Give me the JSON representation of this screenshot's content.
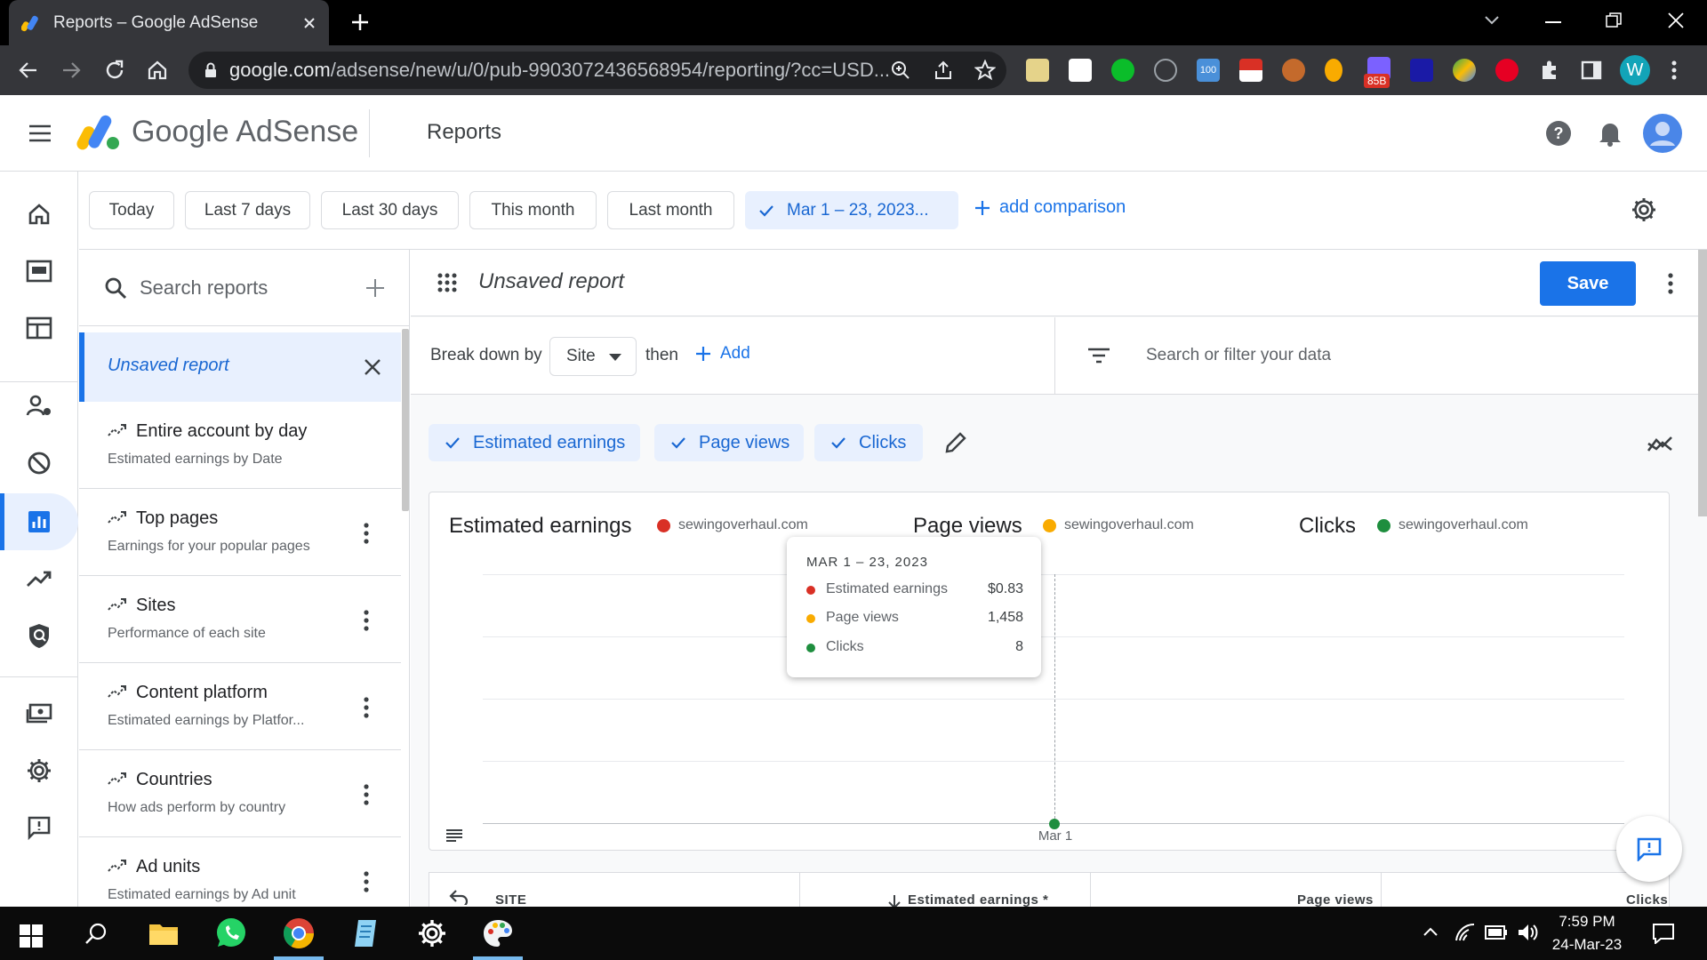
{
  "browser": {
    "tab_title": "Reports – Google AdSense",
    "url_host": "google.com",
    "url_path": "/adsense/new/u/0/pub-9903072436568954/reporting/?cc=USD...",
    "ext_badge": "85B",
    "ext_100": "100",
    "profile_initial": "W"
  },
  "header": {
    "brand": "Google AdSense",
    "page_title": "Reports"
  },
  "date_chips": {
    "today": "Today",
    "last7": "Last 7 days",
    "last30": "Last 30 days",
    "this_month": "This month",
    "last_month": "Last month",
    "selected_range": "Mar 1 – 23, 2023...",
    "add_comparison": "add comparison"
  },
  "sidebar": {
    "search_placeholder": "Search reports",
    "unsaved_label": "Unsaved report",
    "reports": [
      {
        "title": "Entire account by day",
        "subtitle": "Estimated earnings by Date"
      },
      {
        "title": "Top pages",
        "subtitle": "Earnings for your popular pages"
      },
      {
        "title": "Sites",
        "subtitle": "Performance of each site"
      },
      {
        "title": "Content platform",
        "subtitle": "Estimated earnings by Platfor..."
      },
      {
        "title": "Countries",
        "subtitle": "How ads perform by country"
      },
      {
        "title": "Ad units",
        "subtitle": "Estimated earnings by Ad unit"
      }
    ]
  },
  "report": {
    "title": "Unsaved report",
    "save_label": "Save",
    "breakdown_label": "Break down by",
    "breakdown_value": "Site",
    "then_label": "then",
    "add_label": "Add",
    "filter_placeholder": "Search or filter your data",
    "metrics": [
      "Estimated earnings",
      "Page views",
      "Clicks"
    ]
  },
  "chart_data": {
    "type": "line",
    "x": [
      "Mar 1"
    ],
    "xtick_labels": [
      "Mar 1"
    ],
    "panels": [
      {
        "title": "Estimated earnings",
        "series": [
          {
            "name": "sewingoverhaul.com",
            "color": "#d93025",
            "values": [
              0.83
            ]
          }
        ]
      },
      {
        "title": "Page views",
        "series": [
          {
            "name": "sewingoverhaul.com",
            "color": "#f9ab00",
            "values": [
              1458
            ]
          }
        ]
      },
      {
        "title": "Clicks",
        "series": [
          {
            "name": "sewingoverhaul.com",
            "color": "#1e8e3e",
            "values": [
              8
            ]
          }
        ]
      }
    ],
    "tooltip": {
      "header": "MAR 1 – 23, 2023",
      "rows": [
        {
          "name": "Estimated earnings",
          "value": "$0.83",
          "color": "#d93025"
        },
        {
          "name": "Page views",
          "value": "1,458",
          "color": "#f9ab00"
        },
        {
          "name": "Clicks",
          "value": "8",
          "color": "#1e8e3e"
        }
      ]
    }
  },
  "table": {
    "col_site": "SITE",
    "col_earnings": "Estimated earnings *",
    "col_pageviews": "Page views",
    "col_clicks": "Clicks"
  },
  "taskbar": {
    "time": "7:59 PM",
    "date": "24-Mar-23"
  },
  "colors": {
    "accent": "#1a73e8",
    "selected_bg": "#e8f0fe"
  }
}
